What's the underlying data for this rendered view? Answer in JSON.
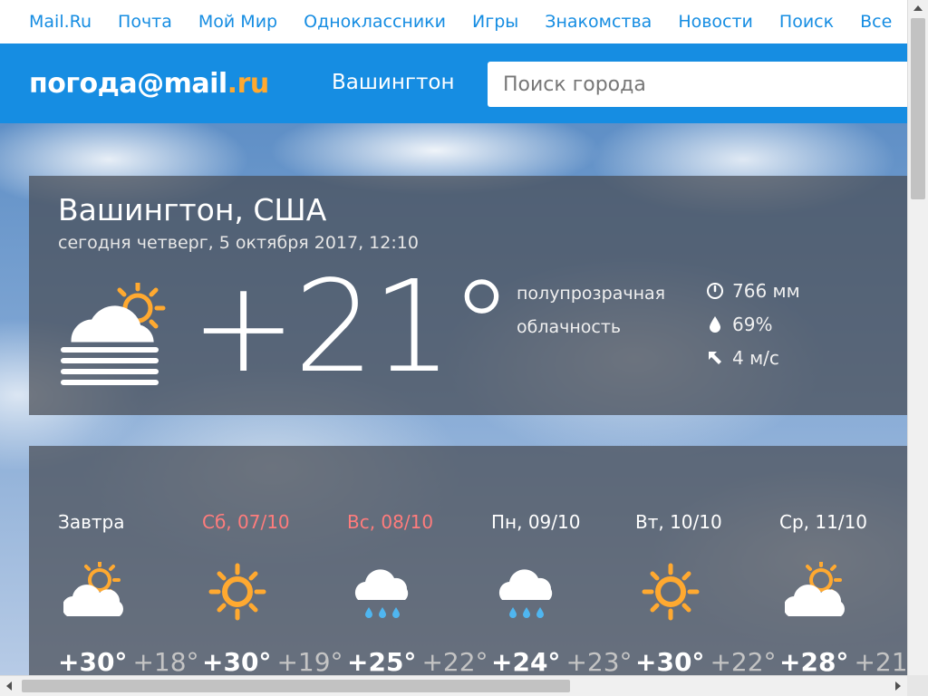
{
  "portal_nav": {
    "links": [
      "Mail.Ru",
      "Почта",
      "Мой Мир",
      "Одноклассники",
      "Игры",
      "Знакомства",
      "Новости",
      "Поиск",
      "Все"
    ]
  },
  "header": {
    "logo_main": "погода@mail",
    "logo_suffix": ".ru",
    "city": "Вашингтон",
    "search_placeholder": "Поиск города"
  },
  "current": {
    "city": "Вашингтон, США",
    "date": "сегодня четверг, 5 октября 2017, 12:10",
    "icon": "partly-cloudy-fog-icon",
    "temperature": "+21°",
    "condition_line1": "полупрозрачная",
    "condition_line2": "облачность",
    "pressure": "766 мм",
    "humidity": "69%",
    "wind": "4 м/с"
  },
  "forecast": [
    {
      "day": "Завтра",
      "weekend": false,
      "icon": "partly-cloudy-icon",
      "max": "+30°",
      "min": "+18°"
    },
    {
      "day": "Сб, 07/10",
      "weekend": true,
      "icon": "sun-icon",
      "max": "+30°",
      "min": "+19°"
    },
    {
      "day": "Вс, 08/10",
      "weekend": true,
      "icon": "rain-icon",
      "max": "+25°",
      "min": "+22°"
    },
    {
      "day": "Пн, 09/10",
      "weekend": false,
      "icon": "rain-icon",
      "max": "+24°",
      "min": "+23°"
    },
    {
      "day": "Вт, 10/10",
      "weekend": false,
      "icon": "sun-icon",
      "max": "+30°",
      "min": "+22°"
    },
    {
      "day": "Ср, 11/10",
      "weekend": false,
      "icon": "partly-cloudy-icon",
      "max": "+28°",
      "min": "+21"
    }
  ],
  "colors": {
    "brand_blue": "#168de2",
    "accent_orange": "#ffa930",
    "weekend_red": "#ff7c7c",
    "panel_bg": "rgba(72,76,84,0.72)"
  }
}
